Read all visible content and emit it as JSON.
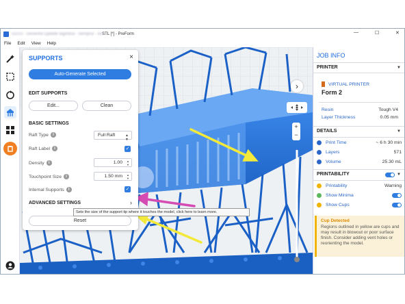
{
  "titlebar": {
    "prefix_blurred": "GD1S - Desenhd Djaldde fagindsa - Semprur - Iol",
    "title_suffix": "STL [*] - PreForm",
    "minimize": "—",
    "maximize": "☐",
    "close": "✕"
  },
  "menu": [
    "File",
    "Edit",
    "View",
    "Help"
  ],
  "supports": {
    "title": "SUPPORTS",
    "close": "×",
    "auto_generate": "Auto-Generate Selected",
    "edit_header": "EDIT SUPPORTS",
    "edit_btn": "Edit...",
    "clean_btn": "Clean",
    "basic_header": "BASIC SETTINGS",
    "raft_type_label": "Raft Type",
    "raft_type_value": "Full Raft",
    "raft_label_label": "Raft Label",
    "density_label": "Density",
    "density_value": "1.00",
    "touchpoint_label": "Touchpoint Size",
    "touchpoint_value": "1.50 mm",
    "internal_label": "Internal Supports",
    "tooltip": "Sets the size of the support tip where it touches the model, click here to learn more.",
    "advanced_header": "ADVANCED SETTINGS",
    "advanced_caret": "›",
    "reset": "Reset"
  },
  "jobinfo": {
    "title": "JOB INFO",
    "printer_header": "PRINTER",
    "virtual_printer": "VIRTUAL PRINTER",
    "printer_name": "Form 2",
    "resin_label": "Resin",
    "resin_value": "Tough V4",
    "layer_label": "Layer Thickness",
    "layer_value": "0.05 mm",
    "details_header": "DETAILS",
    "print_time_label": "Print Time",
    "print_time_value": "~ 6 h 30 min",
    "layers_label": "Layers",
    "layers_value": "571",
    "volume_label": "Volume",
    "volume_value": "25.30 mL",
    "printability_header": "PRINTABILITY",
    "printability_label": "Printability",
    "printability_value": "Warning",
    "show_minima_label": "Show Minima",
    "show_cups_label": "Show Cups",
    "cup_title": "Cup Detected",
    "cup_text": "Regions outlined in yellow are cups and may result in blowout or poor surface finish. Consider adding vent holes or reorienting the model."
  },
  "icons": {
    "magic": "magic-wand-icon",
    "select": "box-select-icon",
    "orient": "orient-icon",
    "supports": "supports-icon",
    "layout": "layout-icon",
    "hollow": "hollow-icon",
    "user": "user-icon"
  },
  "colors": {
    "accent": "#1f6ee0",
    "model_blue": "#1d6fd6",
    "arrow_yellow": "#f2e93a",
    "arrow_pink": "#d44bb3",
    "orange": "#f07f22"
  }
}
